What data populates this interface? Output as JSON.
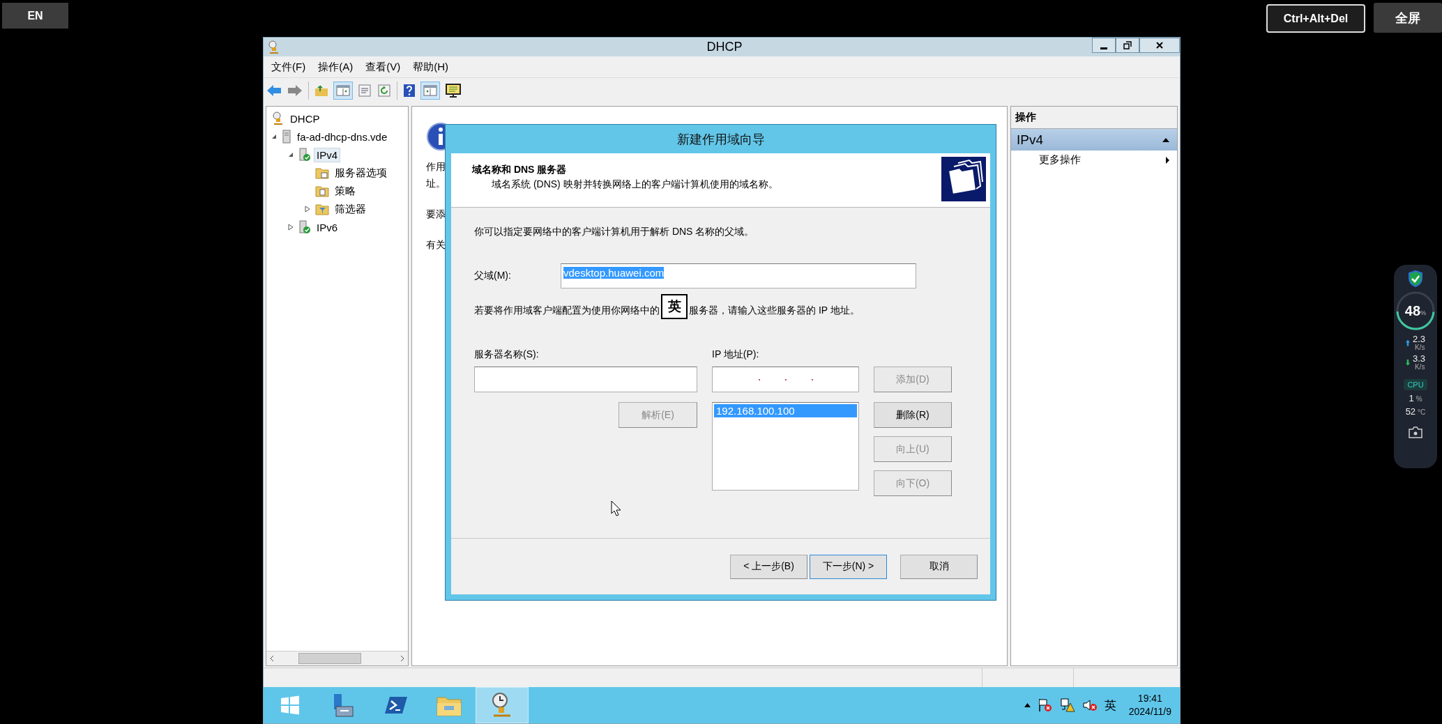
{
  "desktop": {
    "language_button": "EN",
    "ctrl_alt_del_button": "Ctrl+Alt+Del",
    "fullscreen_button": "全屏"
  },
  "monitor_widget": {
    "level": 0.48,
    "percent": "48",
    "percent_unit": "%",
    "upload": "2.3",
    "upload_unit": "K/s",
    "download": "3.3",
    "download_unit": "K/s",
    "cpu_label": "CPU",
    "cpu_usage": "1",
    "cpu_usage_unit": "%",
    "cpu_temp": "52",
    "cpu_temp_unit": "°C"
  },
  "window": {
    "title": "DHCP",
    "menu": [
      "文件(F)",
      "操作(A)",
      "查看(V)",
      "帮助(H)"
    ]
  },
  "tree": [
    {
      "label": "DHCP",
      "kind": "root",
      "selected": false,
      "children": [
        {
          "label": "fa-ad-dhcp-dns.vde",
          "kind": "server",
          "expanded": true,
          "selected": false,
          "children": [
            {
              "label": "IPv4",
              "kind": "protocol",
              "expanded": true,
              "selected": true,
              "children": [
                {
                  "label": "服务器选项",
                  "kind": "options",
                  "selected": false
                },
                {
                  "label": "策略",
                  "kind": "policy",
                  "selected": false
                },
                {
                  "label": "筛选器",
                  "kind": "filter",
                  "expanded": false,
                  "selected": false
                }
              ]
            },
            {
              "label": "IPv6",
              "kind": "protocol",
              "expanded": false,
              "selected": false
            }
          ]
        }
      ]
    }
  ],
  "center_panel": {
    "texts": [
      "作用",
      "址。",
      "要添",
      "有关"
    ]
  },
  "actions_panel": {
    "header": "操作",
    "section": {
      "title": "IPv4",
      "expanded": true
    },
    "items": [
      "更多操作"
    ]
  },
  "wizard": {
    "title": "新建作用域向导",
    "heading": "域名称和 DNS 服务器",
    "subheading": "域名系统 (DNS) 映射并转换网络上的客户端计算机使用的域名称。",
    "intro": "你可以指定要网络中的客户端计算机用于解析 DNS 名称的父域。",
    "parent_domain": {
      "label": "父域(M):",
      "value": "vdesktop.huawei.com",
      "value_selected": true
    },
    "dns_note_before": "若要将作用域客户端配置为使用你网络中的",
    "dns_note_after": "服务器，请输入这些服务器的 IP 地址。",
    "ime_indicator": "英",
    "server_name_label": "服务器名称(S):",
    "ip_label": "IP 地址(P):",
    "resolve_button": {
      "label": "解析(E)",
      "disabled": true
    },
    "ip_list": [
      {
        "text": "192.168.100.100",
        "selected": true
      }
    ],
    "side_buttons": [
      {
        "label": "添加(D)",
        "disabled": true
      },
      {
        "label": "删除(R)",
        "disabled": false
      },
      {
        "label": "向上(U)",
        "disabled": true
      },
      {
        "label": "向下(O)",
        "disabled": true
      }
    ],
    "nav_buttons": [
      {
        "label": "< 上一步(B)",
        "focused": false
      },
      {
        "label": "下一步(N) >",
        "focused": true
      },
      {
        "label": "取消",
        "focused": false
      }
    ]
  },
  "taskbar": {
    "apps": [
      {
        "kind": "start",
        "selected": false
      },
      {
        "kind": "server-manager",
        "selected": false
      },
      {
        "kind": "powershell",
        "selected": false
      },
      {
        "kind": "explorer",
        "selected": false
      },
      {
        "kind": "dhcp",
        "selected": true
      }
    ],
    "ime": "英",
    "time": "19:41",
    "date": "2024/11/9"
  }
}
